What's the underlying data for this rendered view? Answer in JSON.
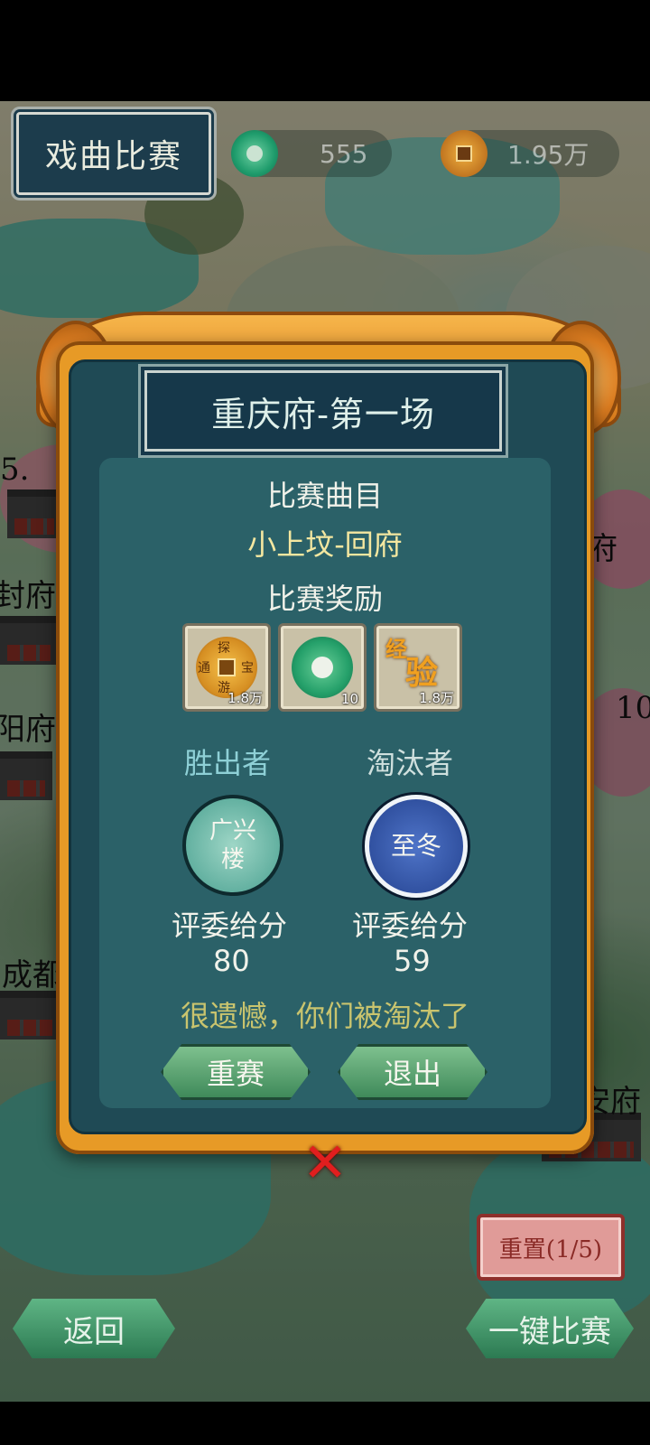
{
  "header": {
    "title": "戏曲比赛",
    "jade_amount": "555",
    "copper_amount": "1.95万"
  },
  "map_labels": [
    "5.",
    "府",
    "封府",
    "阳府",
    "10",
    "成都",
    "安府"
  ],
  "dialog": {
    "title": "重庆府-第一场",
    "song_heading": "比赛曲目",
    "song_name": "小上坟-回府",
    "reward_heading": "比赛奖励",
    "rewards": [
      {
        "icon": "copper-coin-icon",
        "amount": "1.8万",
        "glyphs": [
          "探",
          "宝",
          "通",
          "游"
        ]
      },
      {
        "icon": "jade-coin-icon",
        "amount": "10"
      },
      {
        "icon": "experience-icon",
        "amount": "1.8万",
        "glyphs": [
          "经",
          "验"
        ]
      }
    ],
    "winner": {
      "role": "胜出者",
      "name_line1": "广兴",
      "name_line2": "楼",
      "score_label": "评委给分",
      "score": "80"
    },
    "loser": {
      "role": "淘汰者",
      "name": "至冬",
      "score_label": "评委给分",
      "score": "59"
    },
    "result_message": "很遗憾，你们被淘汰了",
    "rematch_label": "重赛",
    "exit_label": "退出"
  },
  "controls": {
    "reset_label": "重置(1/5)",
    "back_label": "返回",
    "auto_label": "一键比赛"
  },
  "colors": {
    "frame_orange": "#e79a26",
    "dialog_teal": "#2b6168",
    "winner_text": "#8ed0d6",
    "loser_text": "#cfe0de",
    "result_text": "#c9c46e"
  }
}
